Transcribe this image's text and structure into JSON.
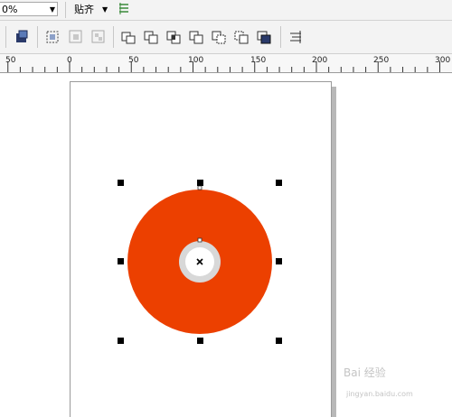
{
  "toolbar": {
    "zoom_value": "0%",
    "snap_label": "贴齐"
  },
  "ruler": {
    "labels": [
      "50",
      "0",
      "50",
      "100",
      "150",
      "200",
      "250",
      "300"
    ]
  },
  "watermark": {
    "text": "Bai 经验",
    "url": "jingyan.baidu.com"
  },
  "colors": {
    "accent_shape": "#ec4000",
    "inner_ring": "#d8d8d8"
  }
}
